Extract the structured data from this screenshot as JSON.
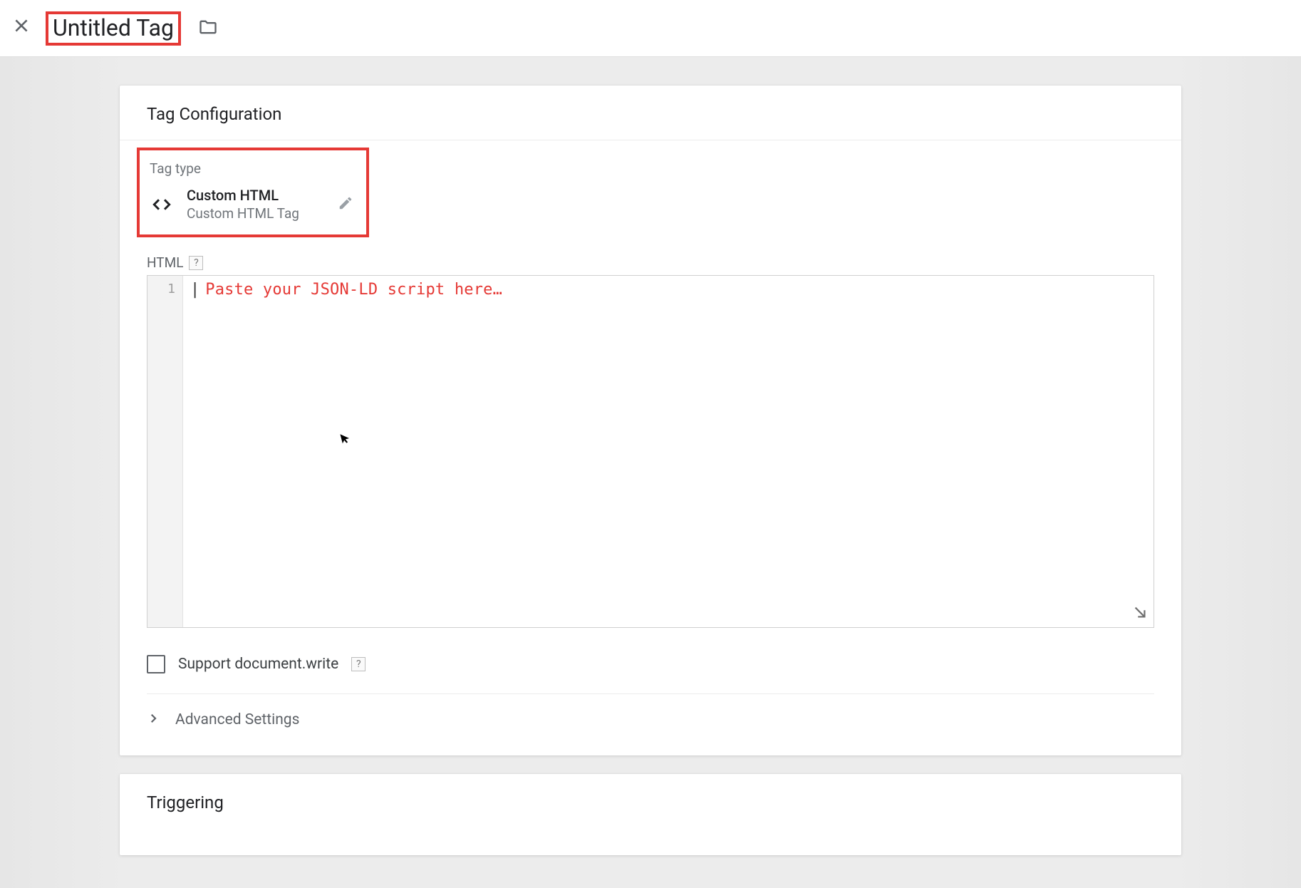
{
  "header": {
    "title": "Untitled Tag"
  },
  "config_card": {
    "title": "Tag Configuration",
    "tag_type_label": "Tag type",
    "tag_type_name": "Custom HTML",
    "tag_type_sub": "Custom HTML Tag",
    "html_label": "HTML",
    "help_glyph": "?",
    "editor_line_number": "1",
    "editor_placeholder": "Paste your JSON-LD script here…",
    "support_doc_write_label": "Support document.write",
    "advanced_label": "Advanced Settings"
  },
  "trigger_card": {
    "title": "Triggering"
  }
}
